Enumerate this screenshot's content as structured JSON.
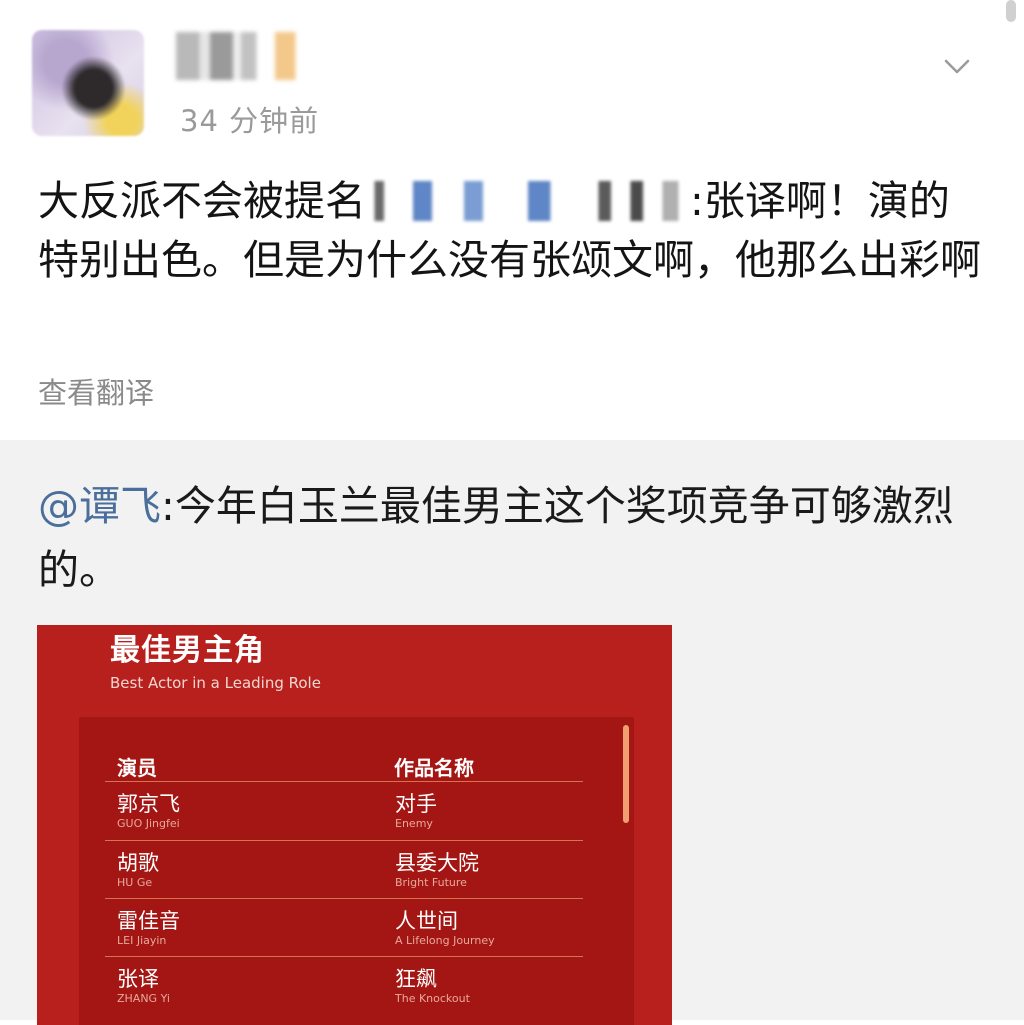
{
  "post": {
    "timestamp": "34 分钟前",
    "text_before": "大反派不会被提名",
    "text_after": ":张译啊！演的特别出色。但是为什么没有张颂文啊，他那么出彩啊",
    "translate_label": "查看翻译"
  },
  "repost": {
    "mention": "@谭飞",
    "text": ":今年白玉兰最佳男主这个奖项竞争可够激烈的。",
    "poster": {
      "title": "最佳男主角",
      "subtitle": "Best Actor in a Leading Role",
      "col_actor": "演员",
      "col_work": "作品名称",
      "rows": [
        {
          "actor": "郭京飞",
          "actor_en": "GUO Jingfei",
          "work": "对手",
          "work_en": "Enemy"
        },
        {
          "actor": "胡歌",
          "actor_en": "HU Ge",
          "work": "县委大院",
          "work_en": "Bright Future"
        },
        {
          "actor": "雷佳音",
          "actor_en": "LEI Jiayin",
          "work": "人世间",
          "work_en": "A Lifelong Journey"
        },
        {
          "actor": "张译",
          "actor_en": "ZHANG Yi",
          "work": "狂飙",
          "work_en": "The Knockout"
        }
      ]
    }
  },
  "icons": {
    "menu": "chevron-down-icon"
  },
  "colors": {
    "mention": "#4b6f9c",
    "poster_red": "#b8201d"
  }
}
